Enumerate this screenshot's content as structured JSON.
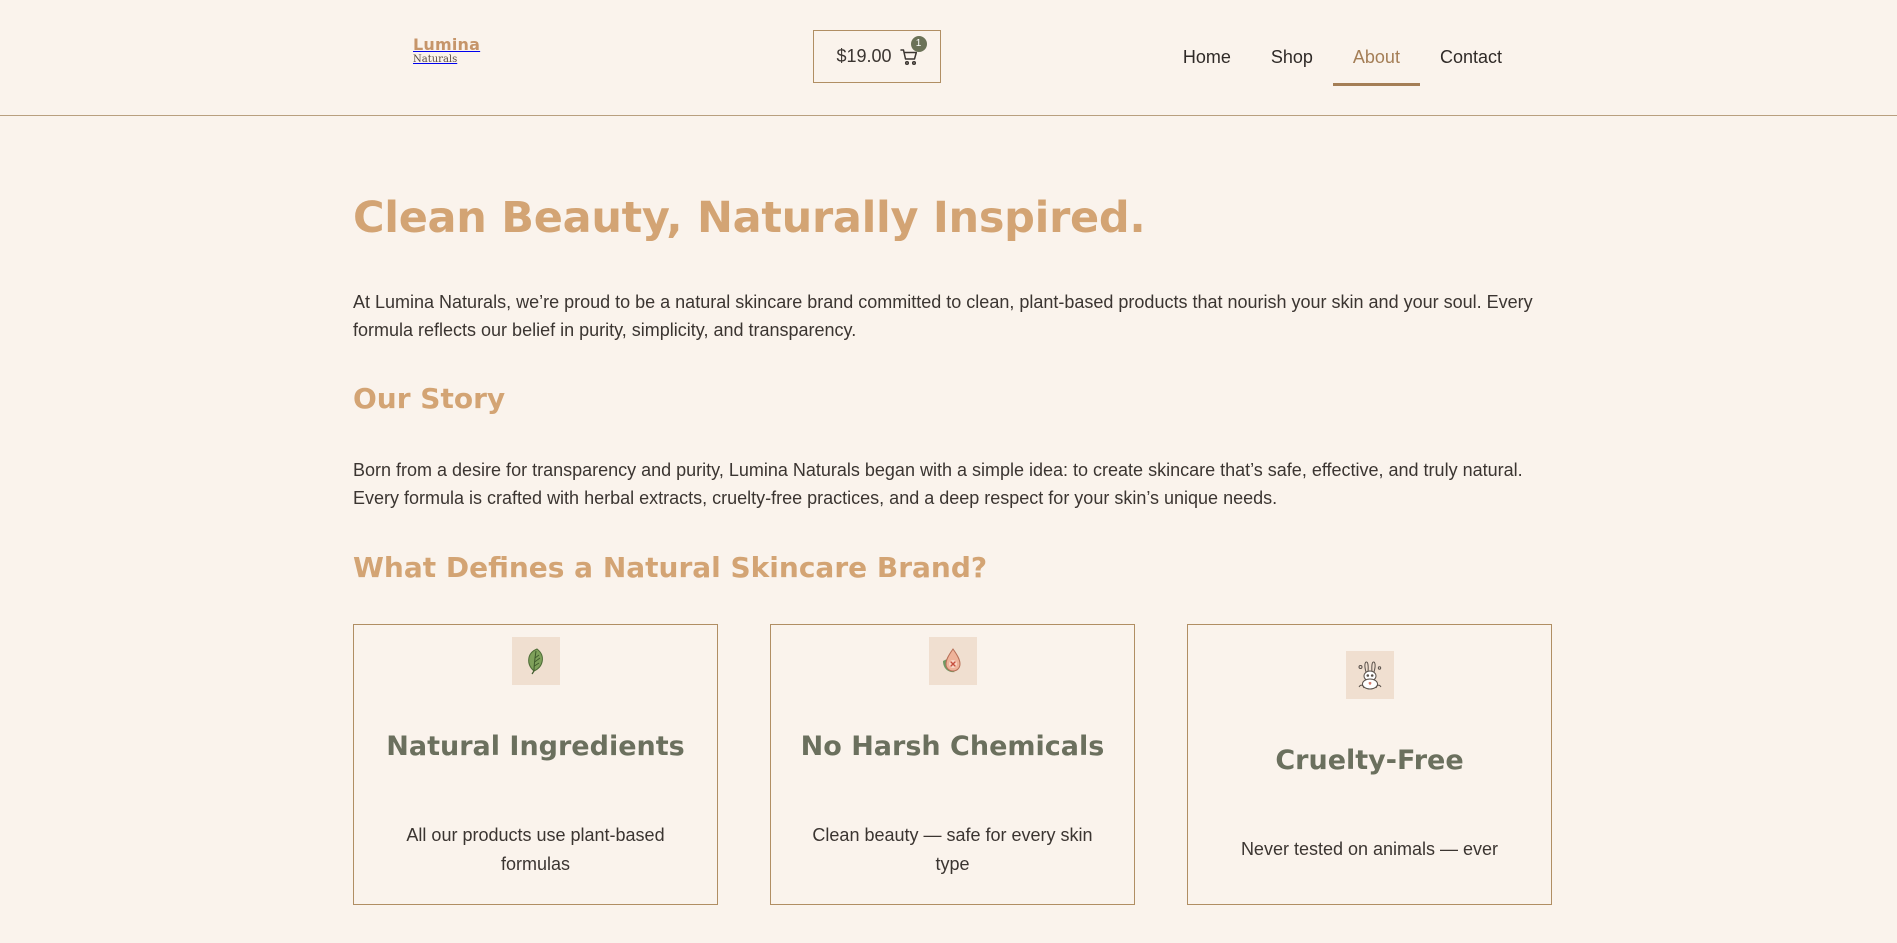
{
  "brand": {
    "title": "Lumina",
    "subtitle": "Naturals"
  },
  "cart": {
    "total": "$19.00",
    "count": "1"
  },
  "nav": {
    "items": [
      {
        "label": "Home",
        "active": false
      },
      {
        "label": "Shop",
        "active": false
      },
      {
        "label": "About",
        "active": true
      },
      {
        "label": "Contact",
        "active": false
      }
    ]
  },
  "hero": {
    "title": "Clean Beauty, Naturally Inspired."
  },
  "intro": {
    "text": "At Lumina Naturals, we’re proud to be a natural skincare brand committed to clean, plant-based products that nourish your skin and your soul. Every formula reflects our belief in purity, simplicity, and transparency."
  },
  "story": {
    "heading": "Our Story",
    "text": "Born from a desire for transparency and purity, Lumina Naturals began with a simple idea: to create skincare that’s safe, effective, and truly natural. Every formula is crafted with herbal extracts, cruelty-free practices, and a deep respect for your skin’s unique needs."
  },
  "defines": {
    "heading": "What Defines a Natural Skincare Brand?",
    "cards": [
      {
        "title": "Natural Ingredients",
        "text": "All our products use plant-based formulas",
        "icon": "leaf-icon"
      },
      {
        "title": "No Harsh Chemicals",
        "text": "Clean beauty — safe for every skin type",
        "icon": "no-chemicals-drop-icon"
      },
      {
        "title": "Cruelty-Free",
        "text": "Never tested on animals — ever",
        "icon": "bunny-icon"
      }
    ]
  },
  "colors": {
    "background": "#faf3ec",
    "accent": "#d3a474",
    "nav_active": "#a47e56",
    "card_title": "#6b705e",
    "border": "#b08e63"
  }
}
